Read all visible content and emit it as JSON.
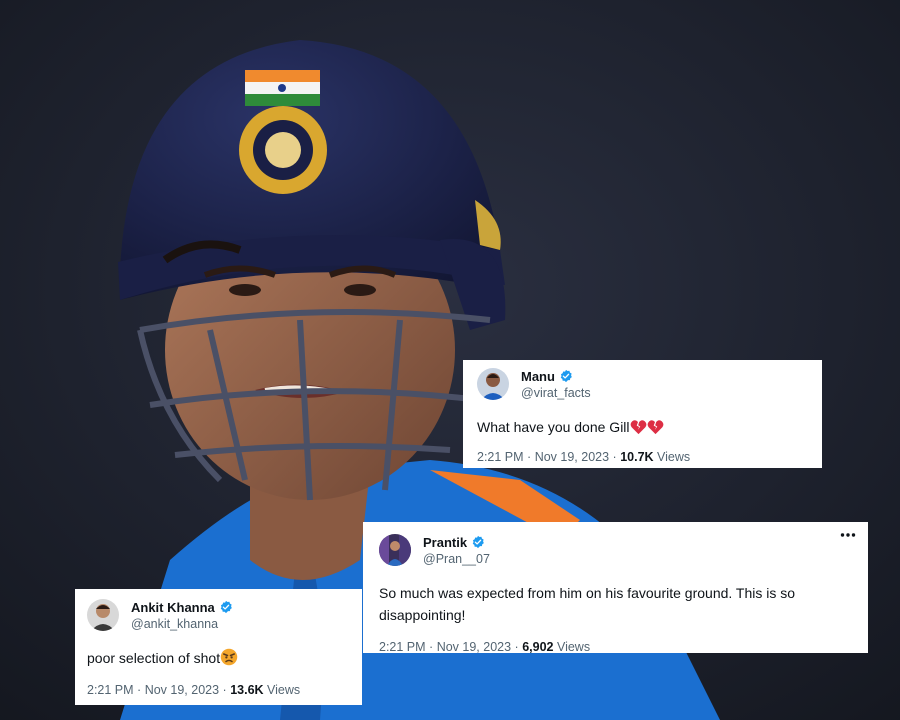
{
  "tweets": [
    {
      "name": "Manu",
      "handle": "@virat_facts",
      "text": "What have you done Gill",
      "text_emoji": [
        "broken-heart",
        "broken-heart"
      ],
      "time": "2:21 PM",
      "date": "Nov 19, 2023",
      "views_count": "10.7K",
      "views_label": "Views"
    },
    {
      "name": "Prantik",
      "handle": "@Pran__07",
      "text": "So much was expected from him on his favourite ground. This is so disappointing!",
      "time": "2:21 PM",
      "date": "Nov 19, 2023",
      "views_count": "6,902",
      "views_label": "Views"
    },
    {
      "name": "Ankit Khanna",
      "handle": "@ankit_khanna",
      "text": "poor selection of shot",
      "text_emoji": [
        "angry-face"
      ],
      "time": "2:21 PM",
      "date": "Nov 19, 2023",
      "views_count": "13.6K",
      "views_label": "Views"
    }
  ],
  "separator": "·",
  "colors": {
    "verified_badge": "#1d9bf0",
    "text_primary": "#0f1419",
    "text_secondary": "#536471",
    "card_bg": "#ffffff"
  },
  "icons": [
    "verified-badge-icon",
    "more-options-icon",
    "broken-heart-emoji",
    "angry-face-emoji"
  ]
}
